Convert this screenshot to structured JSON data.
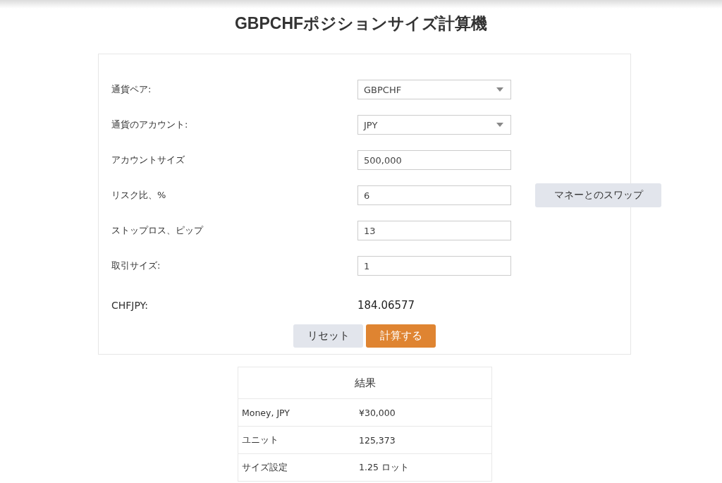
{
  "title": "GBPCHFポジションサイズ計算機",
  "form": {
    "rows": [
      {
        "kind": "select",
        "label": "通貨ペア:",
        "value": "GBPCHF"
      },
      {
        "kind": "select",
        "label": "通貨のアカウント:",
        "value": "JPY"
      },
      {
        "kind": "input",
        "label": "アカウントサイズ",
        "value": "500,000"
      },
      {
        "kind": "input",
        "label": "リスク比、%",
        "value": "6",
        "button": "マネーとのスワップ"
      },
      {
        "kind": "input",
        "label": "ストップロス、ピップ",
        "value": "13"
      },
      {
        "kind": "input",
        "label": "取引サイズ:",
        "value": "1"
      },
      {
        "kind": "readout",
        "label": "CHFJPY:",
        "value": "184.06577"
      }
    ],
    "buttons": [
      {
        "kind": "secondary",
        "label": "リセット"
      },
      {
        "kind": "primary",
        "label": "計算する"
      }
    ]
  },
  "results": {
    "title": "結果",
    "rows": [
      {
        "label": "Money, JPY",
        "value": "¥30,000"
      },
      {
        "label": "ユニット",
        "value": "125,373"
      },
      {
        "label": "サイズ設定",
        "value": "1.25 ロット"
      }
    ]
  }
}
